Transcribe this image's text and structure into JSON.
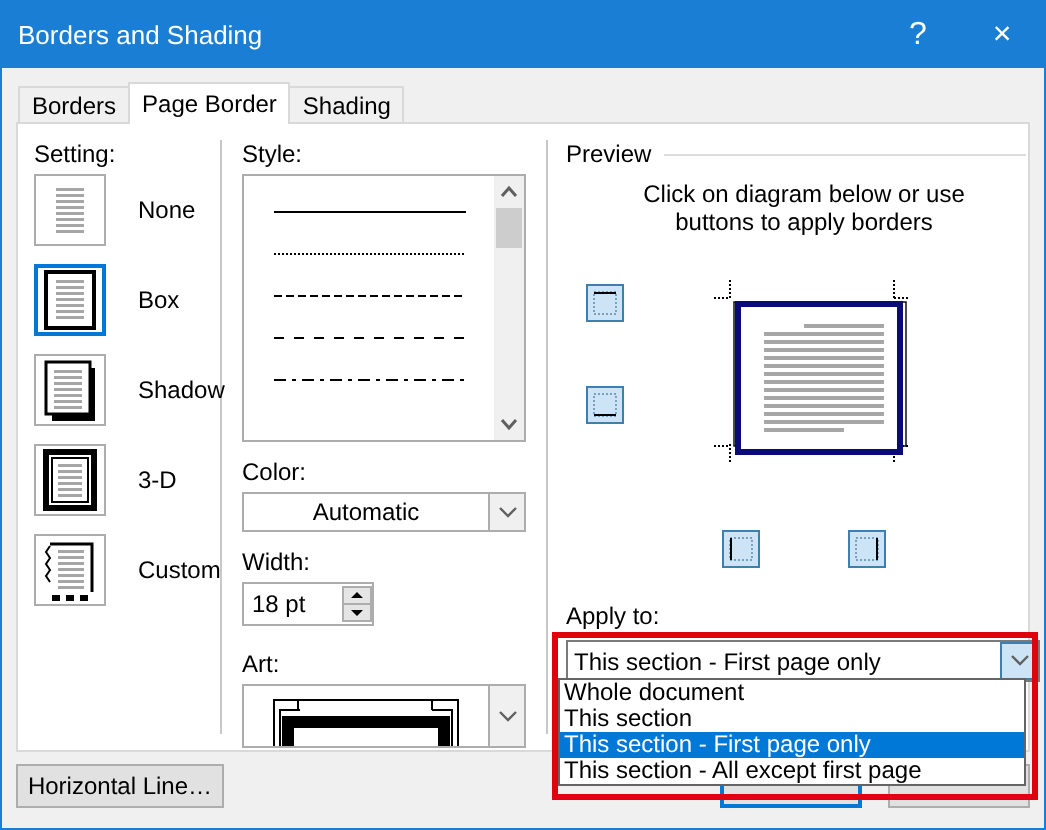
{
  "window": {
    "title": "Borders and Shading",
    "help": "?",
    "close": "×"
  },
  "tabs": [
    {
      "label": "Borders",
      "selected": false
    },
    {
      "label": "Page Border",
      "selected": true
    },
    {
      "label": "Shading",
      "selected": false
    }
  ],
  "setting": {
    "label": "Setting:",
    "options": [
      {
        "label": "None",
        "kind": "none",
        "selected": false
      },
      {
        "label": "Box",
        "kind": "box",
        "selected": true
      },
      {
        "label": "Shadow",
        "kind": "shadow",
        "selected": false
      },
      {
        "label": "3-D",
        "kind": "framed",
        "selected": false
      },
      {
        "label": "Custom",
        "kind": "custom",
        "selected": false
      }
    ]
  },
  "style": {
    "label": "Style:",
    "lines": [
      {
        "kind": "solid"
      },
      {
        "kind": "dotted"
      },
      {
        "kind": "dashed"
      },
      {
        "kind": "dashed-wide"
      },
      {
        "kind": "dash-dot"
      }
    ]
  },
  "color": {
    "label": "Color:",
    "value": "Automatic"
  },
  "width": {
    "label": "Width:",
    "value": "18 pt"
  },
  "art": {
    "label": "Art:"
  },
  "preview": {
    "label": "Preview",
    "hint": "Click on diagram below or use buttons to apply borders"
  },
  "apply_to": {
    "label": "Apply to:",
    "value": "This section - First page only",
    "expanded": true,
    "options": [
      {
        "label": "Whole document",
        "selected": false
      },
      {
        "label": "This section",
        "selected": false
      },
      {
        "label": "This section - First page only",
        "selected": true
      },
      {
        "label": "This section - All except first page",
        "selected": false
      }
    ]
  },
  "buttons": [
    {
      "label": "Horizontal Line…",
      "kind": "text"
    },
    {
      "kind": "ok"
    },
    {
      "kind": "cancel"
    }
  ]
}
